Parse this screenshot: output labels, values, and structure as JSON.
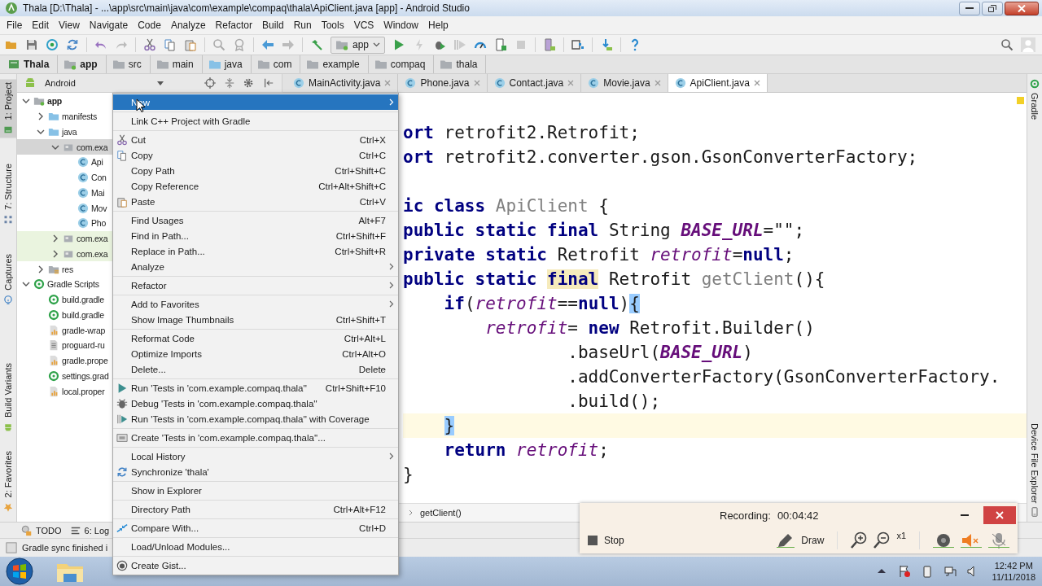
{
  "window": {
    "title": "Thala [D:\\Thala] - ...\\app\\src\\main\\java\\com\\example\\compaq\\thala\\ApiClient.java [app] - Android Studio"
  },
  "menu_bar": [
    "File",
    "Edit",
    "View",
    "Navigate",
    "Code",
    "Analyze",
    "Refactor",
    "Build",
    "Run",
    "Tools",
    "VCS",
    "Window",
    "Help"
  ],
  "toolbar": {
    "run_config": "app"
  },
  "breadcrumb": [
    {
      "label": "Thala",
      "kind": "project"
    },
    {
      "label": "app",
      "kind": "module"
    },
    {
      "label": "src",
      "kind": "folder"
    },
    {
      "label": "main",
      "kind": "folder"
    },
    {
      "label": "java",
      "kind": "source"
    },
    {
      "label": "com",
      "kind": "folder"
    },
    {
      "label": "example",
      "kind": "folder"
    },
    {
      "label": "compaq",
      "kind": "folder"
    },
    {
      "label": "thala",
      "kind": "folder"
    }
  ],
  "left_tools_top": [
    {
      "label": "1: Project",
      "kind": "project",
      "selected": true
    },
    {
      "label": "7: Structure",
      "kind": "structure",
      "selected": false
    },
    {
      "label": "Captures",
      "kind": "captures",
      "selected": false
    }
  ],
  "left_tools_bottom": [
    {
      "label": "Build Variants",
      "kind": "android",
      "selected": false
    },
    {
      "label": "2: Favorites",
      "kind": "star",
      "selected": false
    }
  ],
  "project_panel": {
    "view": "Android",
    "tree": [
      {
        "label": "app",
        "kind": "module",
        "expanded": true,
        "selected": false,
        "children": [
          {
            "label": "manifests",
            "kind": "folder",
            "expanded": false,
            "selected": false
          },
          {
            "label": "java",
            "kind": "folder",
            "expanded": true,
            "selected": false,
            "children": [
              {
                "label": "com.exa",
                "kind": "package",
                "expanded": true,
                "selected": true,
                "children": [
                  {
                    "label": "Api",
                    "kind": "class",
                    "selected": false
                  },
                  {
                    "label": "Con",
                    "kind": "class",
                    "selected": false
                  },
                  {
                    "label": "Mai",
                    "kind": "class",
                    "selected": false
                  },
                  {
                    "label": "Mov",
                    "kind": "class",
                    "selected": false
                  },
                  {
                    "label": "Pho",
                    "kind": "class",
                    "selected": false
                  }
                ]
              },
              {
                "label": "com.exa",
                "kind": "test-package",
                "expanded": false,
                "selected": false
              },
              {
                "label": "com.exa",
                "kind": "test-package",
                "expanded": false,
                "selected": false
              }
            ]
          },
          {
            "label": "res",
            "kind": "res",
            "expanded": false,
            "selected": false
          }
        ]
      },
      {
        "label": "Gradle Scripts",
        "kind": "gradle",
        "expanded": true,
        "selected": false,
        "children": [
          {
            "label": "build.gradle",
            "kind": "gradle",
            "selected": false
          },
          {
            "label": "build.gradle",
            "kind": "gradle",
            "selected": false
          },
          {
            "label": "gradle-wrap",
            "kind": "props",
            "selected": false
          },
          {
            "label": "proguard-ru",
            "kind": "text",
            "selected": false
          },
          {
            "label": "gradle.prope",
            "kind": "props",
            "selected": false
          },
          {
            "label": "settings.grad",
            "kind": "gradle",
            "selected": false
          },
          {
            "label": "local.proper",
            "kind": "props",
            "selected": false
          }
        ]
      }
    ]
  },
  "editor": {
    "tabs": [
      {
        "label": "MainActivity.java",
        "selected": false
      },
      {
        "label": "Phone.java",
        "selected": false
      },
      {
        "label": "Contact.java",
        "selected": false
      },
      {
        "label": "Movie.java",
        "selected": false
      },
      {
        "label": "ApiClient.java",
        "selected": true
      }
    ],
    "lines": [
      {
        "current": false,
        "tokens": [
          {
            "text": "ort",
            "kind": "keyword"
          },
          {
            "text": " retrofit2.Retrofit;",
            "kind": "plain"
          }
        ]
      },
      {
        "current": false,
        "tokens": [
          {
            "text": "ort",
            "kind": "keyword"
          },
          {
            "text": " retrofit2.converter.gson.GsonConverterFactory;",
            "kind": "plain"
          }
        ]
      },
      {
        "current": false
      },
      {
        "current": false,
        "tokens": [
          {
            "text": "ic class ",
            "kind": "keyword"
          },
          {
            "text": "ApiClient",
            "kind": "unused"
          },
          {
            "text": " {",
            "kind": "plain"
          }
        ]
      },
      {
        "current": false,
        "tokens": [
          {
            "text": "public static final",
            "kind": "keyword"
          },
          {
            "text": " String ",
            "kind": "plain"
          },
          {
            "text": "BASE_URL",
            "kind": "constant"
          },
          {
            "text": "=\"\";",
            "kind": "plain"
          }
        ]
      },
      {
        "current": false,
        "tokens": [
          {
            "text": "private static",
            "kind": "keyword"
          },
          {
            "text": " Retrofit ",
            "kind": "plain"
          },
          {
            "text": "retrofit",
            "kind": "field"
          },
          {
            "text": "=",
            "kind": "plain"
          },
          {
            "text": "null",
            "kind": "keyword"
          },
          {
            "text": ";",
            "kind": "plain"
          }
        ]
      },
      {
        "current": false,
        "tokens": [
          {
            "text": "public static ",
            "kind": "keyword"
          },
          {
            "text": "final",
            "kind": "warning"
          },
          {
            "text": " Retrofit ",
            "kind": "plain"
          },
          {
            "text": "getClient",
            "kind": "unused"
          },
          {
            "text": "(){",
            "kind": "plain"
          }
        ]
      },
      {
        "current": false,
        "tokens": [
          {
            "text": "    if",
            "kind": "keyword"
          },
          {
            "text": "(",
            "kind": "plain"
          },
          {
            "text": "retrofit",
            "kind": "field"
          },
          {
            "text": "==",
            "kind": "plain"
          },
          {
            "text": "null",
            "kind": "keyword"
          },
          {
            "text": ")",
            "kind": "plain"
          },
          {
            "text": "{",
            "kind": "brace"
          }
        ]
      },
      {
        "current": false,
        "tokens": [
          {
            "text": "        retrofit",
            "kind": "field"
          },
          {
            "text": "= ",
            "kind": "plain"
          },
          {
            "text": "new",
            "kind": "keyword"
          },
          {
            "text": " Retrofit.Builder()",
            "kind": "plain"
          }
        ]
      },
      {
        "current": false,
        "tokens": [
          {
            "text": "                .baseUrl(",
            "kind": "plain"
          },
          {
            "text": "BASE_URL",
            "kind": "constant"
          },
          {
            "text": ")",
            "kind": "plain"
          }
        ]
      },
      {
        "current": false,
        "tokens": [
          {
            "text": "                .addConverterFactory(GsonConverterFactory.",
            "kind": "plain"
          }
        ]
      },
      {
        "current": false,
        "tokens": [
          {
            "text": "                .build();",
            "kind": "plain"
          }
        ]
      },
      {
        "current": true,
        "tokens": [
          {
            "text": "    }",
            "kind": "brace"
          }
        ]
      },
      {
        "current": false,
        "tokens": [
          {
            "text": "    return ",
            "kind": "keyword"
          },
          {
            "text": "retrofit",
            "kind": "field"
          },
          {
            "text": ";",
            "kind": "plain"
          }
        ]
      },
      {
        "current": false,
        "tokens": [
          {
            "text": "}",
            "kind": "plain"
          }
        ]
      }
    ],
    "breadcrumb": "getClient()"
  },
  "right_tools_top": [
    "Gradle"
  ],
  "right_tools_bottom": [
    "Device File Explorer"
  ],
  "bottom_tools": [
    {
      "label": "TODO",
      "kind": "todo"
    },
    {
      "label": "6: Log",
      "kind": "log"
    }
  ],
  "status_bar": {
    "message": "Gradle sync finished i"
  },
  "context_menu": {
    "groups": [
      {
        "items": [
          {
            "label": "New",
            "kind": "plain",
            "submenu": true,
            "selected": true
          }
        ]
      },
      {
        "items": [
          {
            "label": "Link C++ Project with Gradle",
            "kind": "plain",
            "submenu": false,
            "selected": false
          }
        ]
      },
      {
        "items": [
          {
            "label": "Cut",
            "shortcut": "Ctrl+X",
            "kind": "cut",
            "submenu": false,
            "selected": false
          },
          {
            "label": "Copy",
            "shortcut": "Ctrl+C",
            "kind": "copy",
            "submenu": false,
            "selected": false
          },
          {
            "label": "Copy Path",
            "shortcut": "Ctrl+Shift+C",
            "kind": "plain",
            "submenu": false,
            "selected": false
          },
          {
            "label": "Copy Reference",
            "shortcut": "Ctrl+Alt+Shift+C",
            "kind": "plain",
            "submenu": false,
            "selected": false
          },
          {
            "label": "Paste",
            "shortcut": "Ctrl+V",
            "kind": "paste",
            "submenu": false,
            "selected": false
          }
        ]
      },
      {
        "items": [
          {
            "label": "Find Usages",
            "shortcut": "Alt+F7",
            "kind": "plain",
            "submenu": false,
            "selected": false
          },
          {
            "label": "Find in Path...",
            "shortcut": "Ctrl+Shift+F",
            "kind": "plain",
            "submenu": false,
            "selected": false
          },
          {
            "label": "Replace in Path...",
            "shortcut": "Ctrl+Shift+R",
            "kind": "plain",
            "submenu": false,
            "selected": false
          },
          {
            "label": "Analyze",
            "kind": "plain",
            "submenu": true,
            "selected": false
          }
        ]
      },
      {
        "items": [
          {
            "label": "Refactor",
            "kind": "plain",
            "submenu": true,
            "selected": false
          }
        ]
      },
      {
        "items": [
          {
            "label": "Add to Favorites",
            "kind": "plain",
            "submenu": true,
            "selected": false
          },
          {
            "label": "Show Image Thumbnails",
            "shortcut": "Ctrl+Shift+T",
            "kind": "plain",
            "submenu": false,
            "selected": false
          }
        ]
      },
      {
        "items": [
          {
            "label": "Reformat Code",
            "shortcut": "Ctrl+Alt+L",
            "kind": "plain",
            "submenu": false,
            "selected": false
          },
          {
            "label": "Optimize Imports",
            "shortcut": "Ctrl+Alt+O",
            "kind": "plain",
            "submenu": false,
            "selected": false
          },
          {
            "label": "Delete...",
            "shortcut": "Delete",
            "kind": "plain",
            "submenu": false,
            "selected": false
          }
        ]
      },
      {
        "items": [
          {
            "label": "Run 'Tests in 'com.example.compaq.thala''",
            "shortcut": "Ctrl+Shift+F10",
            "kind": "run",
            "submenu": false,
            "selected": false
          },
          {
            "label": "Debug 'Tests in 'com.example.compaq.thala''",
            "kind": "debug",
            "submenu": false,
            "selected": false
          },
          {
            "label": "Run 'Tests in 'com.example.compaq.thala'' with Coverage",
            "kind": "coverage",
            "submenu": false,
            "selected": false
          }
        ]
      },
      {
        "items": [
          {
            "label": "Create 'Tests in 'com.example.compaq.thala''...",
            "kind": "create",
            "submenu": false,
            "selected": false
          }
        ]
      },
      {
        "items": [
          {
            "label": "Local History",
            "kind": "plain",
            "submenu": true,
            "selected": false
          },
          {
            "label": "Synchronize 'thala'",
            "kind": "sync",
            "submenu": false,
            "selected": false
          }
        ]
      },
      {
        "items": [
          {
            "label": "Show in Explorer",
            "kind": "plain",
            "submenu": false,
            "selected": false
          }
        ]
      },
      {
        "items": [
          {
            "label": "Directory Path",
            "shortcut": "Ctrl+Alt+F12",
            "kind": "plain",
            "submenu": false,
            "selected": false
          }
        ]
      },
      {
        "items": [
          {
            "label": "Compare With...",
            "shortcut": "Ctrl+D",
            "kind": "compare",
            "submenu": false,
            "selected": false
          }
        ]
      },
      {
        "items": [
          {
            "label": "Load/Unload Modules...",
            "kind": "plain",
            "submenu": false,
            "selected": false
          }
        ]
      },
      {
        "items": [
          {
            "label": "Create Gist...",
            "kind": "gist",
            "submenu": false,
            "selected": false
          }
        ]
      }
    ]
  },
  "recorder": {
    "label": "Recording:",
    "time": "00:04:42",
    "stop": "Stop",
    "draw": "Draw",
    "zoom": "x1"
  },
  "taskbar": {
    "time": "12:42 PM",
    "date": "11/11/2018"
  }
}
